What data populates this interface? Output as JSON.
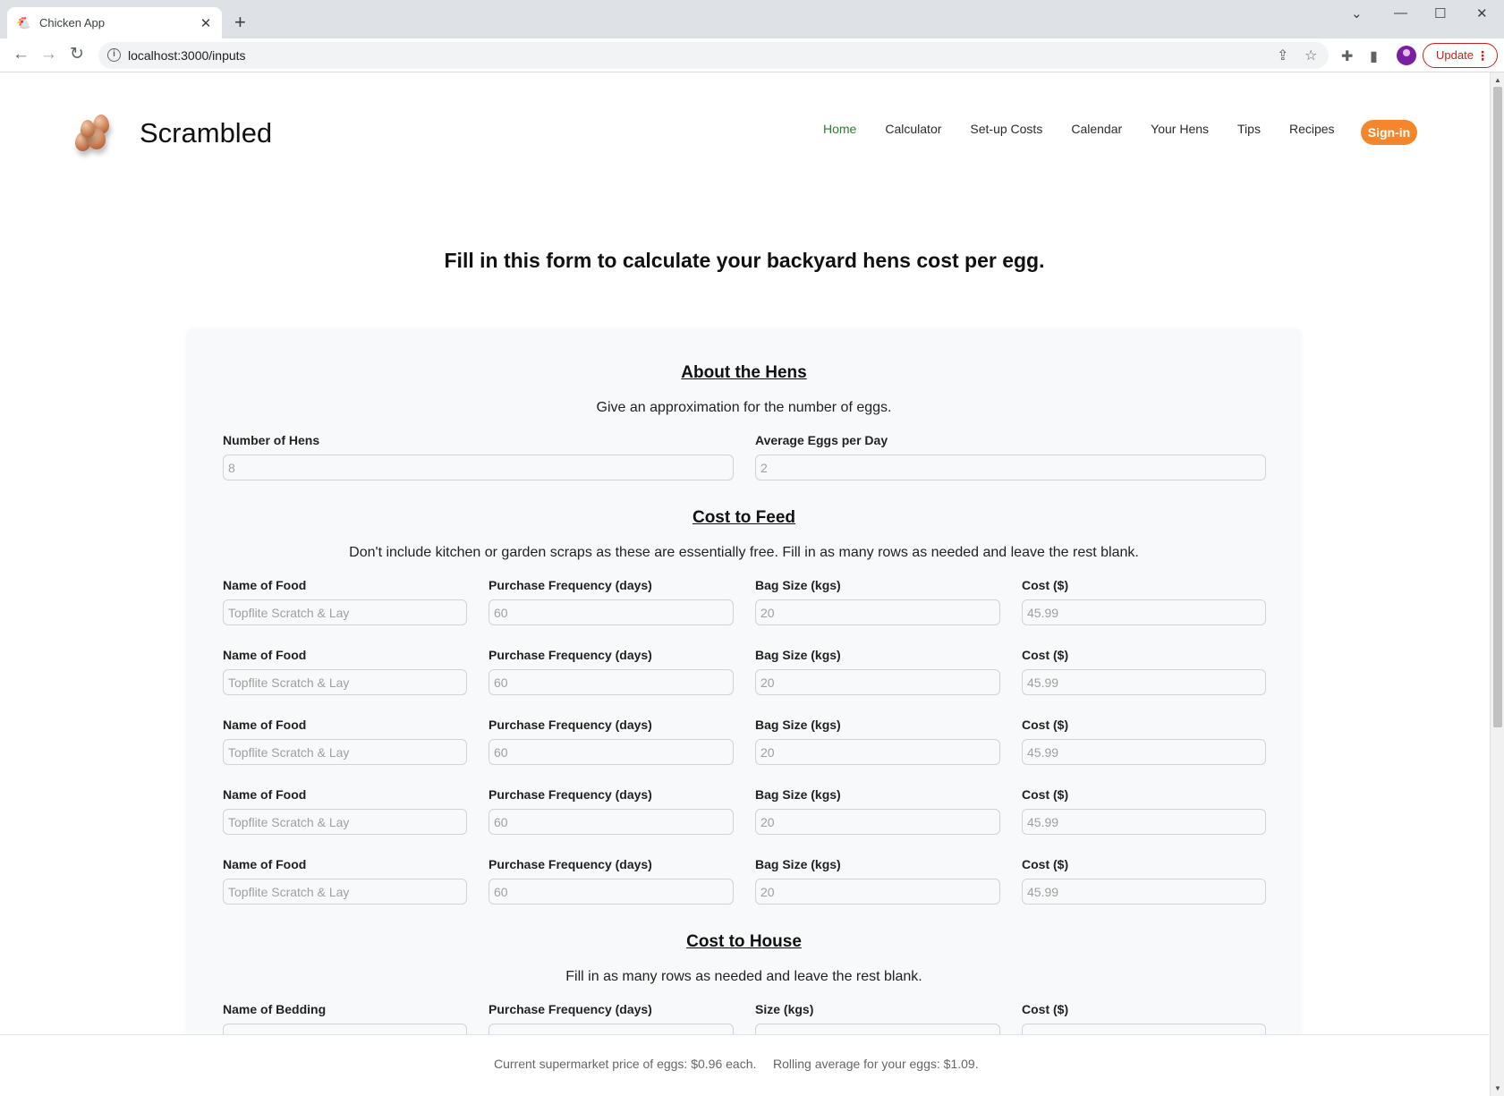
{
  "browser": {
    "tab_title": "Chicken App",
    "tab_favicon": "chicken-icon",
    "url": "localhost:3000/inputs",
    "update_label": "Update"
  },
  "header": {
    "brand": "Scrambled",
    "nav": [
      {
        "label": "Home",
        "active": true
      },
      {
        "label": "Calculator"
      },
      {
        "label": "Set-up Costs"
      },
      {
        "label": "Calendar"
      },
      {
        "label": "Your Hens"
      },
      {
        "label": "Tips"
      },
      {
        "label": "Recipes"
      }
    ],
    "signin_label": "Sign-in"
  },
  "page_title": "Fill in this form to calculate your backyard hens cost per egg.",
  "hens": {
    "title": "About the Hens",
    "description": "Give an approximation for the number of eggs.",
    "number_label": "Number of Hens",
    "number_placeholder": "8",
    "eggs_label": "Average Eggs per Day",
    "eggs_placeholder": "2"
  },
  "feed": {
    "title": "Cost to Feed",
    "description": "Don't include kitchen or garden scraps as these are essentially free. Fill in as many rows as needed and leave the rest blank.",
    "rows": [
      {
        "name_label": "Name of Food",
        "name_placeholder": "Topflite Scratch & Lay",
        "freq_label": "Purchase Frequency (days)",
        "freq_placeholder": "60",
        "size_label": "Bag Size (kgs)",
        "size_placeholder": "20",
        "cost_label": "Cost ($)",
        "cost_placeholder": "45.99"
      },
      {
        "name_label": "Name of Food",
        "name_placeholder": "Topflite Scratch & Lay",
        "freq_label": "Purchase Frequency (days)",
        "freq_placeholder": "60",
        "size_label": "Bag Size (kgs)",
        "size_placeholder": "20",
        "cost_label": "Cost ($)",
        "cost_placeholder": "45.99"
      },
      {
        "name_label": "Name of Food",
        "name_placeholder": "Topflite Scratch & Lay",
        "freq_label": "Purchase Frequency (days)",
        "freq_placeholder": "60",
        "size_label": "Bag Size (kgs)",
        "size_placeholder": "20",
        "cost_label": "Cost ($)",
        "cost_placeholder": "45.99"
      },
      {
        "name_label": "Name of Food",
        "name_placeholder": "Topflite Scratch & Lay",
        "freq_label": "Purchase Frequency (days)",
        "freq_placeholder": "60",
        "size_label": "Bag Size (kgs)",
        "size_placeholder": "20",
        "cost_label": "Cost ($)",
        "cost_placeholder": "45.99"
      },
      {
        "name_label": "Name of Food",
        "name_placeholder": "Topflite Scratch & Lay",
        "freq_label": "Purchase Frequency (days)",
        "freq_placeholder": "60",
        "size_label": "Bag Size (kgs)",
        "size_placeholder": "20",
        "cost_label": "Cost ($)",
        "cost_placeholder": "45.99"
      }
    ]
  },
  "house": {
    "title": "Cost to House",
    "description": "Fill in as many rows as needed and leave the rest blank.",
    "name_label": "Name of Bedding",
    "freq_label": "Purchase Frequency (days)",
    "size_label": "Size (kgs)",
    "cost_label": "Cost ($)"
  },
  "footer": {
    "supermarket": "Current supermarket price of eggs: $0.96 each.",
    "rolling": "Rolling average for your eggs: $1.09."
  },
  "colors": {
    "accent_orange": "#f5862c",
    "active_nav_green": "#2e7d32",
    "update_red": "#c5221f"
  }
}
